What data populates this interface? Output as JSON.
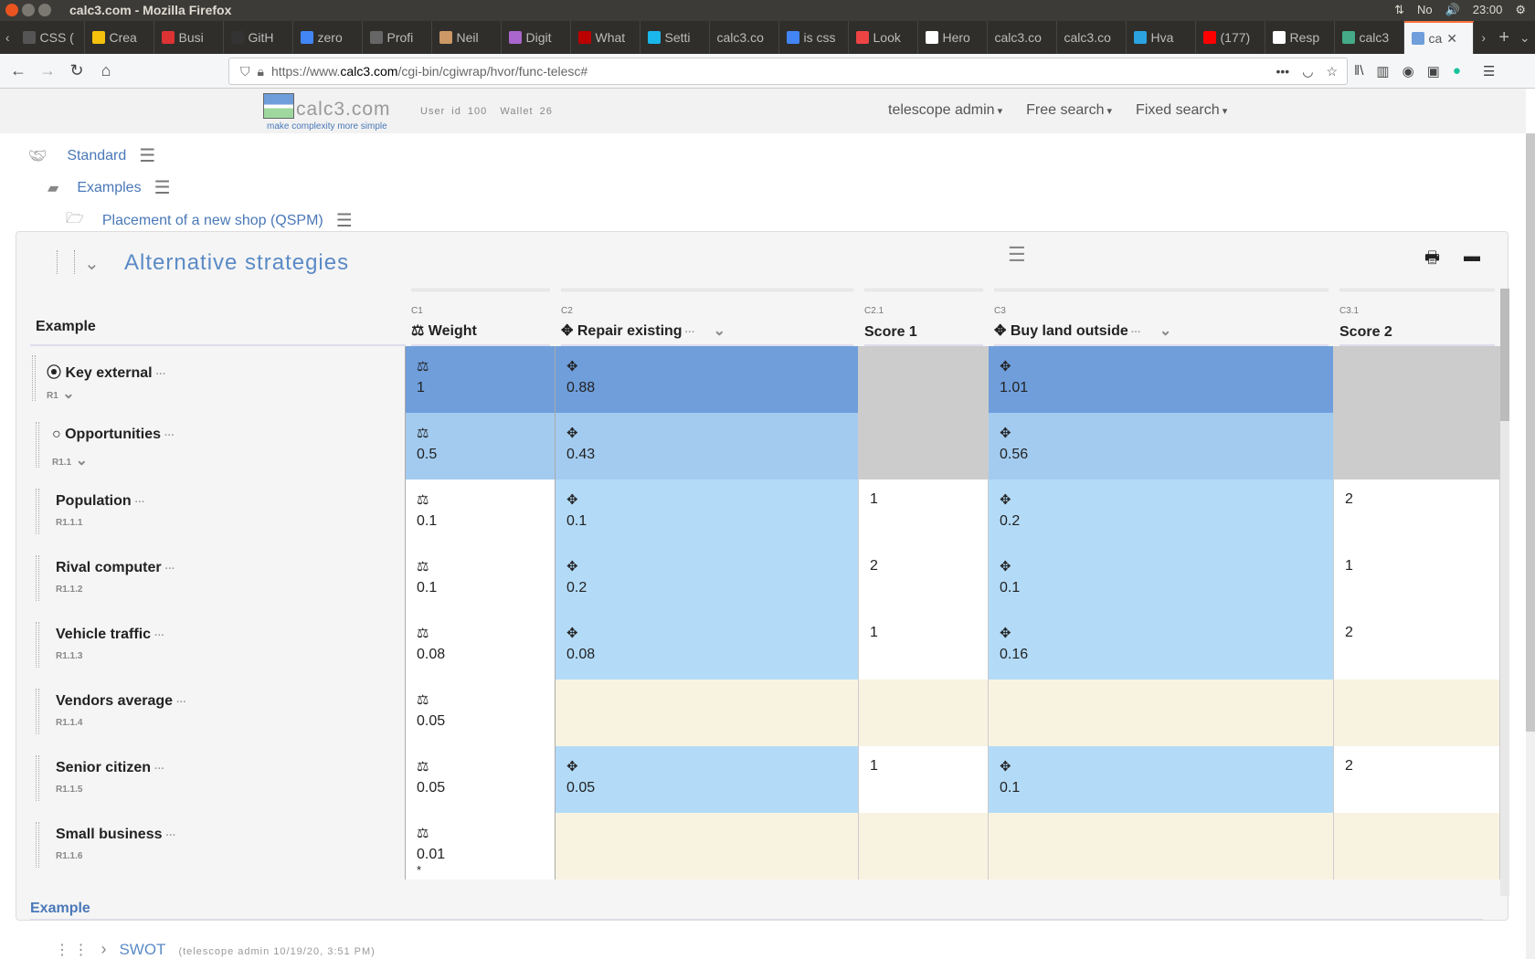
{
  "window": {
    "title": "calc3.com - Mozilla Firefox",
    "clock": "23:00",
    "tray": [
      "⇅",
      "No",
      "🔊"
    ]
  },
  "tabs": [
    {
      "label": "CSS (",
      "color": "#555"
    },
    {
      "label": "Crea",
      "color": "#f4c20d"
    },
    {
      "label": "Busi",
      "color": "#d33"
    },
    {
      "label": "GitH",
      "color": "#333"
    },
    {
      "label": "zero",
      "color": "#4285f4"
    },
    {
      "label": "Profi",
      "color": "#666"
    },
    {
      "label": "Neil",
      "color": "#c96"
    },
    {
      "label": "Digit",
      "color": "#a6c"
    },
    {
      "label": "What",
      "color": "#b00"
    },
    {
      "label": "Setti",
      "color": "#1ab7ea"
    },
    {
      "label": "calc3.co",
      "color": ""
    },
    {
      "label": "is css",
      "color": "#4285f4"
    },
    {
      "label": "Look",
      "color": "#e44"
    },
    {
      "label": "Hero",
      "color": "#fff"
    },
    {
      "label": "calc3.co",
      "color": ""
    },
    {
      "label": "calc3.co",
      "color": ""
    },
    {
      "label": "Hva",
      "color": "#2aa3e0"
    },
    {
      "label": "(177)",
      "color": "#f00"
    },
    {
      "label": "Resp",
      "color": "#fff"
    },
    {
      "label": "calc3",
      "color": "#4a8"
    },
    {
      "label": "ca",
      "color": "#6f9edb",
      "active": true
    }
  ],
  "url": {
    "pre": "https://www.",
    "domain": "calc3.com",
    "path": "/cgi-bin/cgiwrap/hvor/func-telesc#"
  },
  "site": {
    "logo": "calc3.com",
    "tagline": "make complexity more simple",
    "user": "User id 100",
    "wallet": "Wallet 26",
    "menus": [
      "telescope admin",
      "Free search",
      "Fixed search"
    ]
  },
  "breadcrumbs": [
    "Standard",
    "Examples",
    "Placement of a new shop (QSPM)"
  ],
  "panel": {
    "title": "Alternative strategies",
    "footer": "Example"
  },
  "colors": {
    "dark_blue": "#6f9edb",
    "mid_blue": "#a3cbf0",
    "light_blue": "#b3dbf8",
    "gray": "#cccccc",
    "beige": "#f8f3e1",
    "white": "#ffffff"
  },
  "columns": [
    {
      "code": "",
      "label": "Example"
    },
    {
      "code": "C1",
      "label": "Weight",
      "icon": "⚖"
    },
    {
      "code": "C2",
      "label": "Repair existing",
      "icon": "✥",
      "menu": true
    },
    {
      "code": "C2.1",
      "label": "Score 1"
    },
    {
      "code": "C3",
      "label": "Buy land outside",
      "icon": "✥",
      "menu": true
    },
    {
      "code": "C3.1",
      "label": "Score 2"
    }
  ],
  "rows": [
    {
      "name": "Key external",
      "id": "R1",
      "marker": "⦿",
      "level": 0,
      "weight": "1",
      "c2": "0.88",
      "s1": "",
      "c3": "1.01",
      "s2": ""
    },
    {
      "name": "Opportunities",
      "id": "R1.1",
      "marker": "○",
      "level": 1,
      "weight": "0.5",
      "c2": "0.43",
      "s1": "",
      "c3": "0.56",
      "s2": ""
    },
    {
      "name": "Population",
      "id": "R1.1.1",
      "level": 2,
      "weight": "0.1",
      "c2": "0.1",
      "s1": "1",
      "c3": "0.2",
      "s2": "2"
    },
    {
      "name": "Rival computer",
      "id": "R1.1.2",
      "level": 2,
      "weight": "0.1",
      "c2": "0.2",
      "s1": "2",
      "c3": "0.1",
      "s2": "1"
    },
    {
      "name": "Vehicle traffic",
      "id": "R1.1.3",
      "level": 2,
      "weight": "0.08",
      "c2": "0.08",
      "s1": "1",
      "c3": "0.16",
      "s2": "2"
    },
    {
      "name": "Vendors average",
      "id": "R1.1.4",
      "level": 2,
      "weight": "0.05",
      "c2": "",
      "s1": "",
      "c3": "",
      "s2": ""
    },
    {
      "name": "Senior citizen",
      "id": "R1.1.5",
      "level": 2,
      "weight": "0.05",
      "c2": "0.05",
      "s1": "1",
      "c3": "0.1",
      "s2": "2"
    },
    {
      "name": "Small business",
      "id": "R1.1.6",
      "level": 2,
      "weight": "0.01",
      "note": "*",
      "c2": "",
      "s1": "",
      "c3": "",
      "s2": ""
    }
  ],
  "next": {
    "title": "SWOT",
    "meta": "(telescope admin 10/19/20, 3:51 PM)"
  }
}
